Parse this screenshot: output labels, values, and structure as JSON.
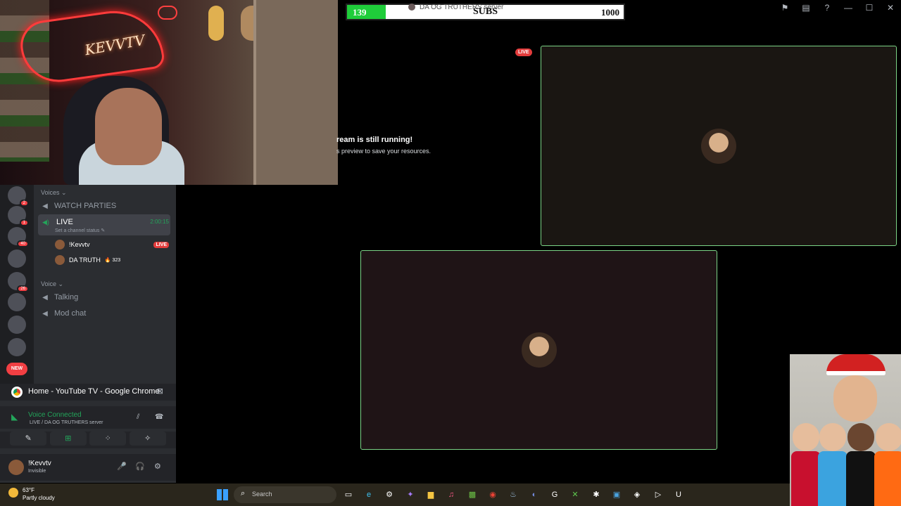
{
  "subgoal": {
    "current": "139",
    "label": "SUBS",
    "goal": "1000",
    "progress": 0.139
  },
  "server_overlay": "DA OG TRUTHERS server",
  "titlebar": {
    "icons": [
      "flag-icon",
      "inbox-icon",
      "help-icon",
      "minimize-icon",
      "maximize-icon",
      "close-icon"
    ],
    "glyphs": [
      "⚑",
      "▤",
      "?",
      "—",
      "☐",
      "✕"
    ]
  },
  "stream_notice": {
    "title": "ream is still running!",
    "subtitle": "s preview to save your resources."
  },
  "live_badge": "LIVE",
  "webcam": {
    "neon_text": "KEVVTV"
  },
  "guild_badges": {
    "g1": "2",
    "g2": "1",
    "g3": "40",
    "g4": "26",
    "new": "NEW"
  },
  "channels": {
    "category_voices": "Voices ⌄",
    "watch_parties": "WATCH PARTIES",
    "live_channel": {
      "name": "LIVE",
      "status": "Set a channel status ✎",
      "time": "2:00:15"
    },
    "members": [
      {
        "name": "!Kevvtv",
        "badge": "LIVE"
      },
      {
        "name": "DA TRUTH",
        "flair": "🔥 323"
      }
    ],
    "category_voice": "Voice ⌄",
    "talking": "Talking",
    "mod_chat": "Mod chat"
  },
  "panel": {
    "chrome_title": "Home - YouTube TV - Google Chrome",
    "voice_status": "Voice Connected",
    "voice_location": "LIVE / DA OG TRUTHERS server",
    "actions": [
      "✎",
      "⊞",
      "⁘",
      "✧"
    ],
    "user": {
      "name": "!Kevvtv",
      "status": "Invisible"
    },
    "controls": [
      "🎤",
      "🎧",
      "⚙"
    ]
  },
  "taskbar": {
    "temp": "63°F",
    "condition": "Partly cloudy",
    "search": "Search",
    "apps": [
      "task-view-icon",
      "edge-icon",
      "settings-icon",
      "copilot-icon",
      "files-icon",
      "music-icon",
      "minecraft-icon",
      "chrome-icon",
      "steam-icon",
      "discord-icon",
      "app-icon",
      "xbox-icon",
      "app2-icon",
      "photos-icon",
      "app3-icon",
      "app4-icon",
      "unreal-icon"
    ],
    "app_glyphs": [
      "▭",
      "e",
      "⚙",
      "✦",
      "▆",
      "♫",
      "▩",
      "◉",
      "♨",
      "◐",
      "G",
      "✕",
      "✱",
      "▣",
      "◈",
      "▷",
      "U"
    ]
  }
}
